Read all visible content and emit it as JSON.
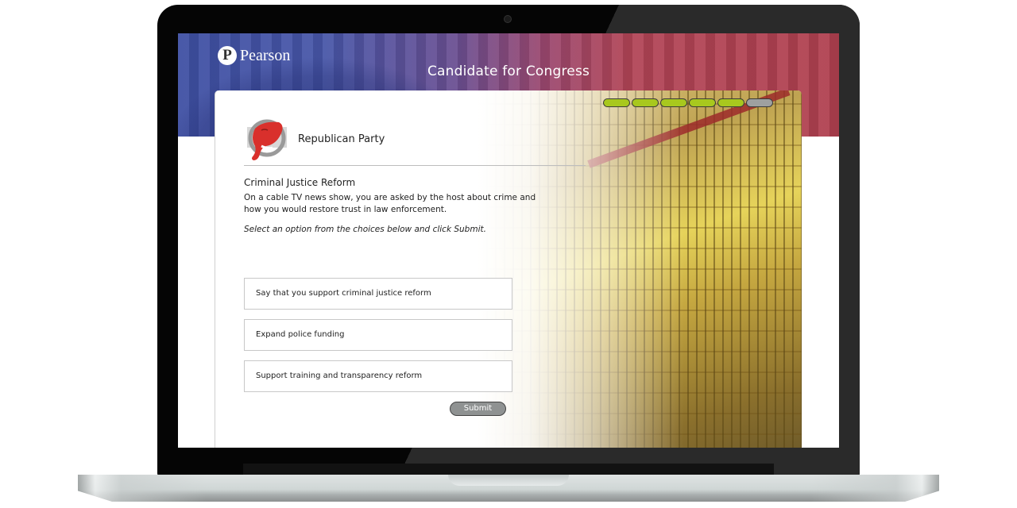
{
  "header": {
    "brand": "Pearson",
    "brand_mark": "P",
    "title": "Candidate for Congress"
  },
  "progress": {
    "completed": 5,
    "total": 6,
    "colors": {
      "done": "#a8c81e",
      "todo": "#9ea0a0"
    }
  },
  "party": {
    "name": "Republican Party",
    "icon": "elephant-icon",
    "color": "#d9302c"
  },
  "question": {
    "title": "Criminal Justice Reform",
    "body": "On a cable TV news show, you are asked by the host about crime and how you would restore trust in law enforcement.",
    "instruction": "Select an option from the choices below and click Submit."
  },
  "options": [
    {
      "label": "Say that you support criminal justice reform"
    },
    {
      "label": "Expand police funding"
    },
    {
      "label": "Support training and transparency reform"
    }
  ],
  "submit_label": "Submit"
}
